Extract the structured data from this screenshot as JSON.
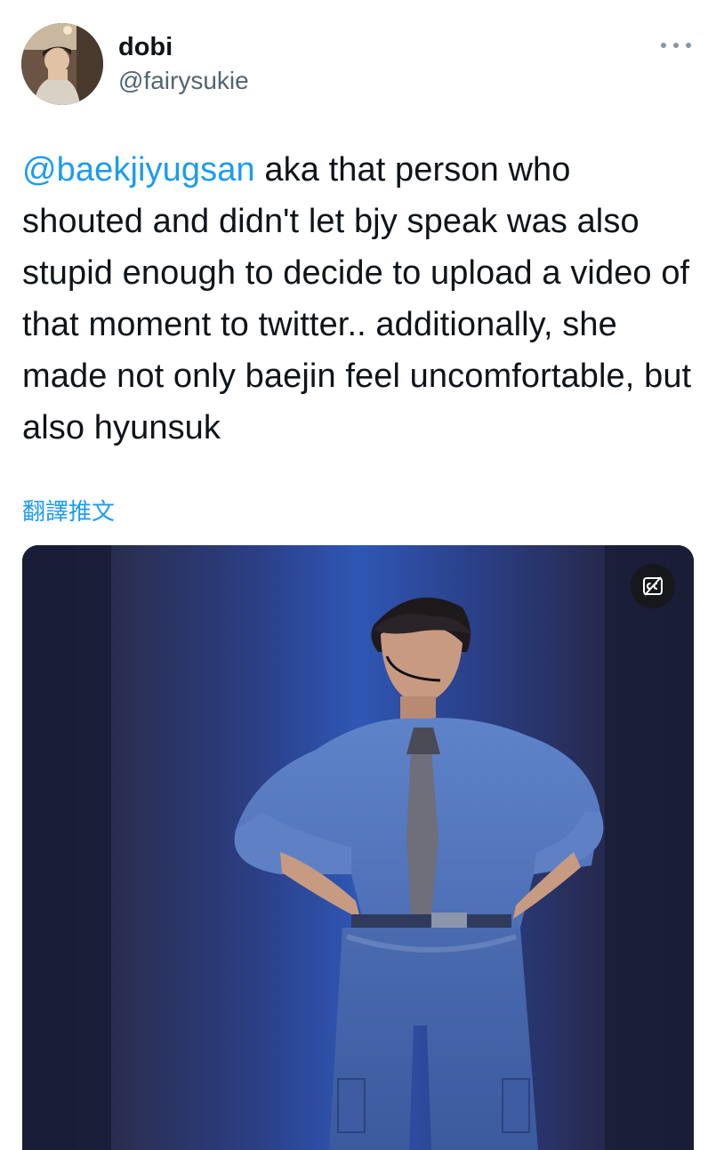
{
  "author": {
    "display_name": "dobi",
    "handle": "@fairysukie"
  },
  "icons": {
    "more": "more-horizontal-icon",
    "captions": "closed-captions-icon"
  },
  "tweet": {
    "mention": "@baekjiyugsan",
    "body": " aka that person who shouted and didn't let bjy speak was also stupid enough to decide to upload a video of that moment to twitter.. additionally, she made not only baejin feel uncomfortable, but also hyunsuk"
  },
  "translate_label": "翻譯推文",
  "colors": {
    "link": "#1d9bf0",
    "text": "#0f1419",
    "secondary": "#536471"
  }
}
